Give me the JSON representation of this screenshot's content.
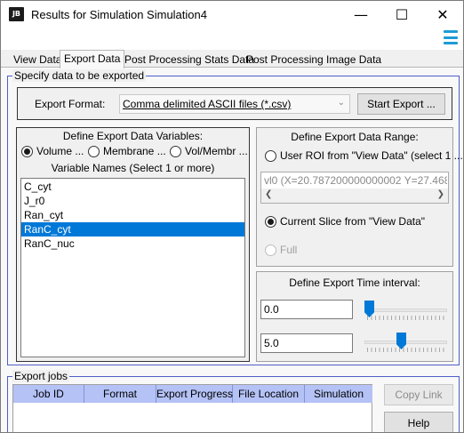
{
  "window": {
    "logo": "JB",
    "title": "Results for Simulation Simulation4",
    "minimize": "—",
    "maximize": "☐",
    "close": "✕"
  },
  "tabs": [
    {
      "label": "View Data"
    },
    {
      "label": "Export Data"
    },
    {
      "label": "Post Processing Stats Data"
    },
    {
      "label": "Post Processing Image Data"
    }
  ],
  "specify": {
    "legend": "Specify data to be exported",
    "format_label": "Export Format:",
    "format_value": "Comma delimited ASCII files (*.csv)",
    "start_button": "Start Export ..."
  },
  "variables": {
    "header": "Define Export Data Variables:",
    "radios": [
      {
        "label": "Volume ...",
        "selected": true
      },
      {
        "label": "Membrane ...",
        "selected": false
      },
      {
        "label": "Vol/Membr ...",
        "selected": false
      }
    ],
    "names_label": "Variable Names (Select 1 or more)",
    "items": [
      "C_cyt",
      "J_r0",
      "Ran_cyt",
      "RanC_cyt",
      "RanC_nuc"
    ],
    "selected_index": 3
  },
  "range": {
    "header": "Define Export Data Range:",
    "roi_label": "User ROI from \"View Data\" (select 1 ...",
    "roi_value": "vl0 (X=20.787200000000002 Y=27.468799",
    "current_slice_label": "Current Slice from \"View Data\"",
    "full_label": "Full",
    "arrow_left": "❮",
    "arrow_right": "❯"
  },
  "time": {
    "header": "Define Export Time interval:",
    "start_value": "0.0",
    "end_value": "5.0",
    "start_fraction": 0.0,
    "end_fraction": 0.44
  },
  "jobs": {
    "legend": "Export jobs",
    "columns": [
      "Job ID",
      "Format",
      "Export Progress",
      "File Location",
      "Simulation"
    ],
    "copy_link_button": "Copy Link",
    "help_button": "Help"
  }
}
